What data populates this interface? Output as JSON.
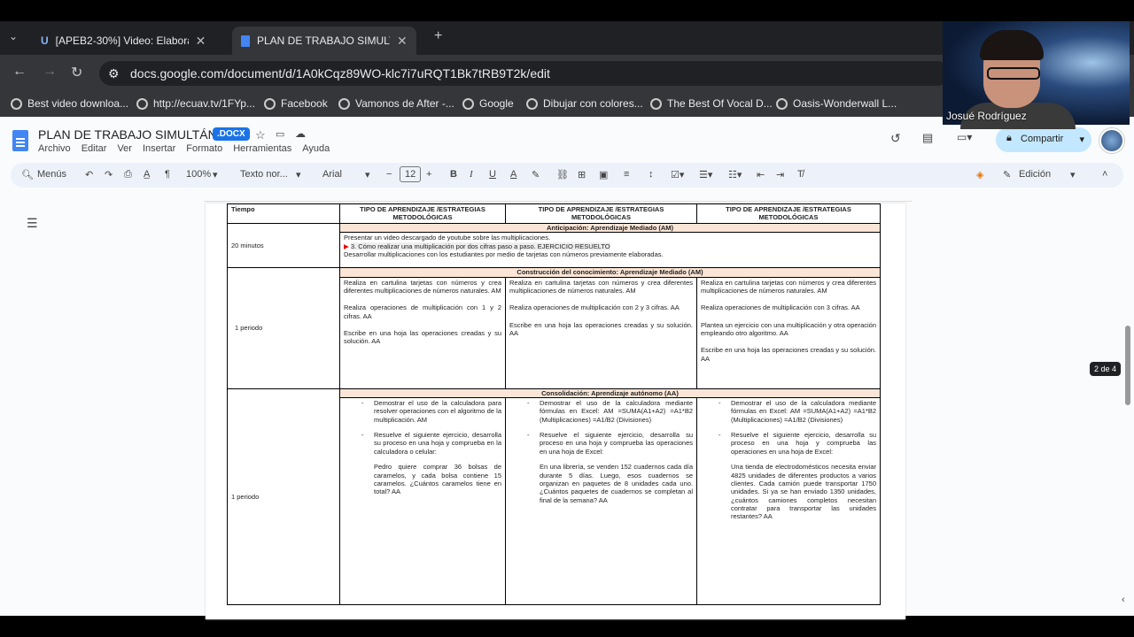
{
  "browser": {
    "tabs": [
      {
        "title": "[APEB2-30%] Video: Elabora un",
        "icon": "U"
      },
      {
        "title": "PLAN DE TRABAJO SIMULTÁNEO",
        "icon": "docs"
      }
    ],
    "url": "docs.google.com/document/d/1A0kCqz89WO-klc7i7uRQT1Bk7tRB9T2k/edit",
    "bookmarks": [
      "Best video downloa...",
      "http://ecuav.tv/1FYp...",
      "Facebook",
      "Vamonos de After -...",
      "Google",
      "Dibujar con colores...",
      "The Best Of Vocal D...",
      "Oasis-Wonderwall L..."
    ]
  },
  "doc": {
    "title": "PLAN DE TRABAJO SIMULTÁNEO",
    "badge": ".DOCX",
    "menus": [
      "Archivo",
      "Editar",
      "Ver",
      "Insertar",
      "Formato",
      "Herramientas",
      "Ayuda"
    ],
    "share": "Compartir",
    "toolbar": {
      "search": "Menús",
      "zoom": "100%",
      "style": "Texto nor...",
      "font": "Arial",
      "size": "12",
      "mode": "Edición"
    },
    "page_indicator": "2 de 4"
  },
  "table": {
    "headers": [
      "Tiempo",
      "TIPO DE APRENDIZAJE /ESTRATEGIAS METODOLÓGICAS",
      "TIPO DE APRENDIZAJE /ESTRATEGIAS METODOLÓGICAS",
      "TIPO DE APRENDIZAJE /ESTRATEGIAS METODOLÓGICAS"
    ],
    "sec1": "Anticipación: Aprendizaje Mediado (AM)",
    "row1_time": "20 minutos",
    "row1_l1": "Presentar un video descargado de youtube sobre las multiplicaciones.",
    "row1_l2": "3. Cómo realizar una multiplicación por dos cifras paso a paso. EJERCICIO RESUELTO",
    "row1_l3": "Desarrollar multiplicaciones con los estudiantes por medio de tarjetas con números previamente elaboradas.",
    "sec2": "Construcción del conocimiento: Aprendizaje Mediado (AM)",
    "row2_time": "1 periodo",
    "row2_c1": [
      "Realiza en cartulina tarjetas con números y crea diferentes multiplicaciones de números naturales. AM",
      "Realiza operaciones de multiplicación con 1 y 2 cifras. AA",
      "Escribe en una hoja las operaciones creadas y su solución. AA"
    ],
    "row2_c2": [
      "Realiza en cartulina tarjetas con números y crea diferentes multiplicaciones de números naturales. AM",
      "Realiza operaciones de multiplicación con 2 y 3 cifras. AA",
      "Escribe en una hoja las operaciones creadas y su solución. AA"
    ],
    "row2_c3": [
      "Realiza en cartulina tarjetas con números y crea diferentes multiplicaciones de números naturales. AM",
      "Realiza operaciones de multiplicación con 3 cifras. AA",
      "Plantea un ejercicio con una multiplicación y otra operación empleando otro algoritmo. AA",
      "Escribe en una hoja las operaciones creadas y su solución. AA"
    ],
    "sec3": "Consolidación: Aprendizaje autónomo (AA)",
    "row3_time": "1 periodo",
    "row3_c1": [
      "Demostrar el uso de la calculadora para resolver operaciones con el algoritmo de la multiplicación. AM",
      "Resuelve el siguiente ejercicio, desarrolla su proceso en una hoja y comprueba en la calculadora o celular:",
      "Pedro quiere comprar 36 bolsas de caramelos, y cada bolsa contiene 15 caramelos. ¿Cuántos caramelos tiene en total? AA"
    ],
    "row3_c2": [
      "Demostrar el uso de la calculadora mediante fórmulas en Excel: AM =SUMA(A1+A2) =A1*B2 (Multiplicaciones) =A1/B2 (Divisiones)",
      "Resuelve el siguiente ejercicio, desarrolla su proceso en una hoja y comprueba las operaciones en una hoja de Excel:",
      "En una librería, se venden 152 cuadernos cada día durante 5 días. Luego, esos cuadernos se organizan en paquetes de 8 unidades cada uno. ¿Cuántos paquetes de cuadernos se completan al final de la semana? AA"
    ],
    "row3_c3": [
      "Demostrar el uso de la calculadora mediante fórmulas en Excel: AM =SUMA(A1+A2) =A1*B2 (Multiplicaciones) =A1/B2 (Divisiones)",
      "Resuelve el siguiente ejercicio, desarrolla su proceso en una hoja y comprueba las operaciones en una hoja de Excel:",
      "Una tienda de electrodomésticos necesita enviar 4825 unidades de diferentes productos a varios clientes. Cada camión puede transportar 1750 unidades. Si ya se han enviado 1350 unidades, ¿cuántos camiones completos necesitan contratar para transportar las unidades restantes? AA"
    ]
  },
  "webcam": {
    "name": "Josué Rodríguez"
  }
}
